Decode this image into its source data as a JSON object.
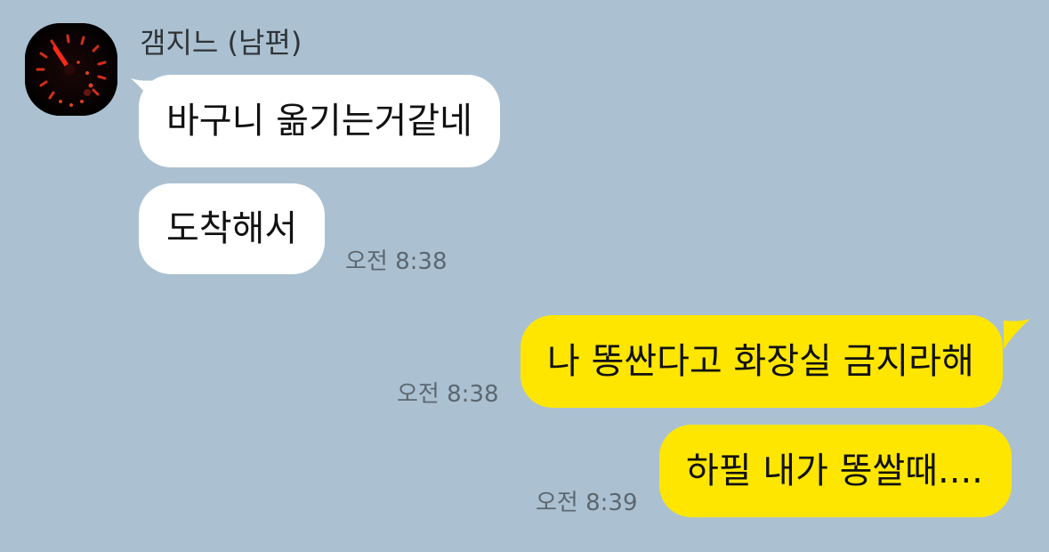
{
  "sender": {
    "name": "갬지느 (남편)",
    "avatar_icon": "speedometer-avatar-icon"
  },
  "messages": [
    {
      "direction": "incoming",
      "text": "바구니 옮기는거같네",
      "time": ""
    },
    {
      "direction": "incoming",
      "text": "도착해서",
      "time": "오전 8:38"
    },
    {
      "direction": "outgoing",
      "text": "나 똥싼다고 화장실 금지라해",
      "time": "오전 8:38"
    },
    {
      "direction": "outgoing",
      "text": "하필 내가 똥쌀때....",
      "time": "오전 8:39"
    }
  ],
  "colors": {
    "background": "#abc1d1",
    "incoming_bubble": "#ffffff",
    "outgoing_bubble": "#ffe600",
    "timestamp": "#5c6770"
  }
}
